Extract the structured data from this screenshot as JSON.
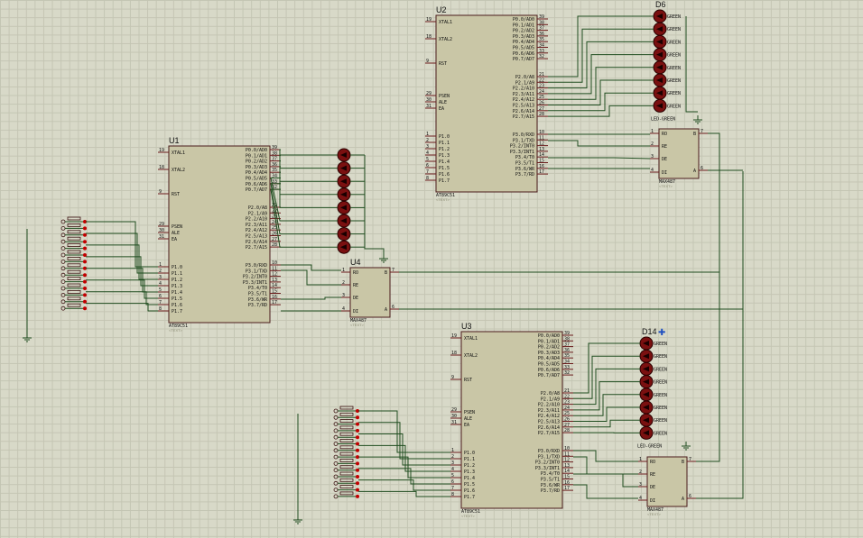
{
  "components": {
    "u1": {
      "ref": "U1",
      "part": "AT89C51",
      "text_ph": "<TEXT>"
    },
    "u2": {
      "ref": "U2",
      "part": "AT89C51",
      "text_ph": "<TEXT>"
    },
    "u3": {
      "ref": "U3",
      "part": "AT89C51",
      "text_ph": "<TEXT>"
    },
    "u4": {
      "ref": "U4",
      "part": "MAX487",
      "text_ph": "<TEXT>"
    },
    "u5": {
      "part": "MAX487",
      "text_ph": "<TEXT>"
    },
    "u6": {
      "part": "MAX487",
      "text_ph": "<TEXT>"
    },
    "d6": {
      "ref": "D6",
      "led_label": "GREEN",
      "part": "LED-GREEN"
    },
    "d14": {
      "ref": "D14",
      "led_label": "GREEN",
      "part": "LED-GREEN"
    }
  },
  "mcu_left_pins": [
    {
      "num": "19",
      "name": "XTAL1"
    },
    {
      "num": "18",
      "name": "XTAL2"
    },
    {
      "num": "9",
      "name": "RST"
    },
    {
      "num": "29",
      "name": "PSEN"
    },
    {
      "num": "30",
      "name": "ALE"
    },
    {
      "num": "31",
      "name": "EA"
    },
    {
      "num": "1",
      "name": "P1.0"
    },
    {
      "num": "2",
      "name": "P1.1"
    },
    {
      "num": "3",
      "name": "P1.2"
    },
    {
      "num": "4",
      "name": "P1.3"
    },
    {
      "num": "5",
      "name": "P1.4"
    },
    {
      "num": "6",
      "name": "P1.5"
    },
    {
      "num": "7",
      "name": "P1.6"
    },
    {
      "num": "8",
      "name": "P1.7"
    }
  ],
  "mcu_right_pins": [
    {
      "num": "39",
      "name": "P0.0/AD0"
    },
    {
      "num": "38",
      "name": "P0.1/AD1"
    },
    {
      "num": "37",
      "name": "P0.2/AD2"
    },
    {
      "num": "36",
      "name": "P0.3/AD3"
    },
    {
      "num": "35",
      "name": "P0.4/AD4"
    },
    {
      "num": "34",
      "name": "P0.5/AD5"
    },
    {
      "num": "33",
      "name": "P0.6/AD6"
    },
    {
      "num": "32",
      "name": "P0.7/AD7"
    },
    {
      "num": "21",
      "name": "P2.0/A8"
    },
    {
      "num": "22",
      "name": "P2.1/A9"
    },
    {
      "num": "23",
      "name": "P2.2/A10"
    },
    {
      "num": "24",
      "name": "P2.3/A11"
    },
    {
      "num": "25",
      "name": "P2.4/A12"
    },
    {
      "num": "26",
      "name": "P2.5/A13"
    },
    {
      "num": "27",
      "name": "P2.6/A14"
    },
    {
      "num": "28",
      "name": "P2.7/A15"
    },
    {
      "num": "10",
      "name": "P3.0/RXD"
    },
    {
      "num": "11",
      "name": "P3.1/TXD"
    },
    {
      "num": "12",
      "name": "P3.2/INT0"
    },
    {
      "num": "13",
      "name": "P3.3/INT1"
    },
    {
      "num": "14",
      "name": "P3.4/T0"
    },
    {
      "num": "15",
      "name": "P3.5/T1"
    },
    {
      "num": "16",
      "name": "P3.6/WR"
    },
    {
      "num": "17",
      "name": "P3.7/RD"
    }
  ],
  "max_pins_left": [
    {
      "num": "1",
      "name": "RO"
    },
    {
      "num": "2",
      "name": "RE"
    },
    {
      "num": "3",
      "name": "DE"
    },
    {
      "num": "4",
      "name": "DI"
    }
  ],
  "max_pins_right": [
    {
      "num": "7",
      "name": "B"
    },
    {
      "num": "6",
      "name": "A"
    }
  ]
}
